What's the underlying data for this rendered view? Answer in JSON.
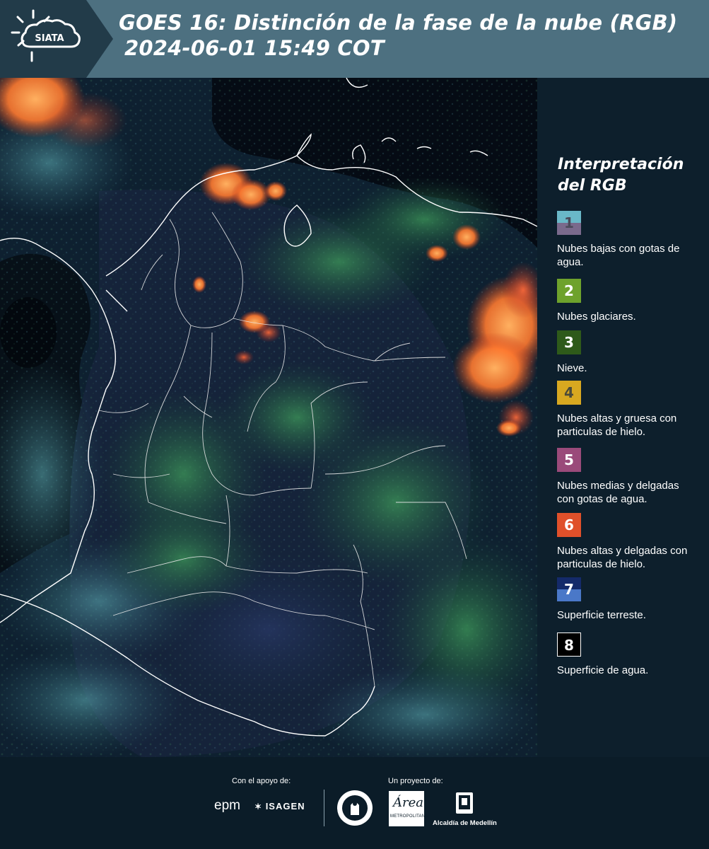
{
  "header": {
    "logo_text": "SIATA",
    "title_line1": "GOES 16: Distinción de la fase de la nube (RGB)",
    "title_line2": "2024-06-01 15:49 COT"
  },
  "legend": {
    "title": "Interpretación del RGB",
    "items": [
      {
        "number": "1",
        "label": "Nubes bajas con gotas de agua.",
        "color_top": "#6ab8c8",
        "color_bottom": "#7a6a8c",
        "number_color": "#4a4a5a"
      },
      {
        "number": "2",
        "label": "Nubes glaciares.",
        "color_top": "#6ea22c",
        "color_bottom": "#6ea22c",
        "number_color": "#ffffff"
      },
      {
        "number": "3",
        "label": "Nieve.",
        "color_top": "#2e5a1a",
        "color_bottom": "#2e5a1a",
        "number_color": "#ffffff"
      },
      {
        "number": "4",
        "label": "Nubes altas y gruesa con particulas de hielo.",
        "color_top": "#d8a820",
        "color_bottom": "#d8a820",
        "number_color": "#4a4a3a"
      },
      {
        "number": "5",
        "label": "Nubes medias y delgadas con gotas de agua.",
        "color_top": "#9a4a7a",
        "color_bottom": "#9a4a7a",
        "number_color": "#ffffff"
      },
      {
        "number": "6",
        "label": "Nubes altas y delgadas con particulas de hielo.",
        "color_top": "#e0502a",
        "color_bottom": "#e0502a",
        "number_color": "#ffffff"
      },
      {
        "number": "7",
        "label": "Superficie terreste.",
        "color_top": "#142a6a",
        "color_bottom": "#4a78c8",
        "number_color": "#ffffff"
      },
      {
        "number": "8",
        "label": "Superficie de agua.",
        "color_top": "#000000",
        "color_bottom": "#000000",
        "number_color": "#ffffff"
      }
    ]
  },
  "footer": {
    "support_label": "Con el apoyo de:",
    "project_label": "Un proyecto de:",
    "epm_text": "epm",
    "isagen_text": "ISAGEN",
    "area_text": "Área",
    "area_subtext": "METROPOLITANA",
    "alcaldia_text": "Alcaldía de Medellín"
  },
  "colors": {
    "header_bg": "#4d7080",
    "panel_bg": "#0d1f2c",
    "cloud_orange": "#ff8a3a",
    "cloud_green": "#3a8a4a",
    "cloud_teal": "#4aa0a8",
    "land_blue": "#1a2a4a",
    "water": "#050a12"
  }
}
